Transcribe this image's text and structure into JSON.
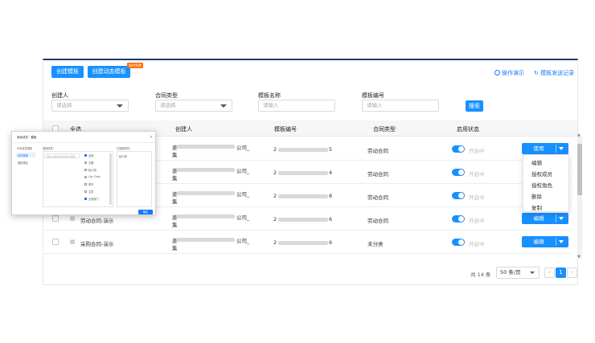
{
  "toolbar": {
    "create_template": "创建模板",
    "create_dynamic_template": "创建动态模板",
    "badge": "限时免费",
    "guide_link": "操作演示",
    "records_link": "模板发送记录"
  },
  "filters": {
    "creator": {
      "label": "创建人",
      "placeholder": "请选择"
    },
    "contract_type": {
      "label": "合同类型",
      "placeholder": "请选择"
    },
    "template_name": {
      "label": "模板名称",
      "placeholder": "请输入"
    },
    "template_no": {
      "label": "模板编号",
      "placeholder": "请输入"
    },
    "search_button": "搜索"
  },
  "table": {
    "columns": [
      "全选",
      "创建人",
      "模板编号",
      "合同类型",
      "启用状态"
    ],
    "rows": [
      {
        "name": "",
        "creator_suffix": "公司_",
        "creator_line2": "集",
        "no_prefix": "2",
        "no_suffix": "5",
        "type": "劳动合同",
        "status": "开启中",
        "action": "使用"
      },
      {
        "name": "",
        "creator_suffix": "公司_",
        "creator_line2": "集",
        "no_prefix": "2",
        "no_suffix": "4",
        "type": "劳动合同",
        "status": "开启中",
        "action": "编辑"
      },
      {
        "name": "",
        "creator_suffix": "公司_",
        "creator_line2": "集",
        "no_prefix": "2",
        "no_suffix": "8",
        "type": "劳动合同",
        "status": "开启中",
        "action": "编辑"
      },
      {
        "name": "劳动合同-演示",
        "creator_suffix": "公司_",
        "creator_line2": "集",
        "no_prefix": "2",
        "no_suffix": "6",
        "type": "劳动合同",
        "status": "开启中",
        "action": "编辑"
      },
      {
        "name": "采购合同-演示",
        "creator_suffix": "公司_",
        "creator_line2": "集",
        "no_prefix": "2",
        "no_suffix": "6",
        "type": "未分类",
        "status": "开启中",
        "action": "编辑"
      }
    ]
  },
  "dropdown_menu": [
    "编辑",
    "授权成员",
    "授权角色",
    "删除",
    "复制"
  ],
  "pagination": {
    "total": "共 14 条",
    "page_size": "50 条/页",
    "current_page": "1"
  },
  "dialog": {
    "title": "添加成员 · 模板",
    "left_items": [
      "可为成员授权",
      "成员管理",
      "授权角色"
    ],
    "middle_header": "选择成员：",
    "search_placeholder": "请输入成员名称/手机号/邮箱",
    "tree_items": [
      "全部",
      "王娜",
      "赵小明",
      "Lily Chen",
      "李华",
      "文员",
      "业务部门"
    ],
    "right_header": "已选择成员：",
    "selected": "赵小明",
    "confirm": "确定"
  },
  "colors": {
    "primary": "#1890ff",
    "badge": "#ff6a00",
    "card_top_border": "#1e3a6d"
  }
}
